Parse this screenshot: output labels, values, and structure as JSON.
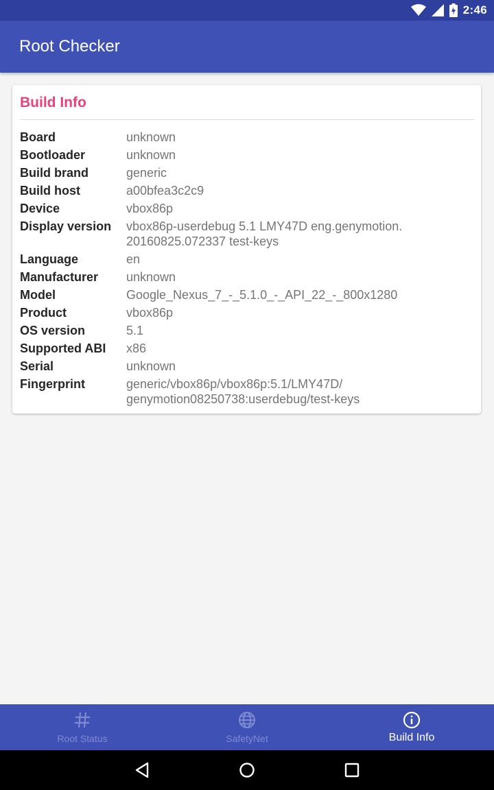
{
  "status_bar": {
    "time": "2:46",
    "icons": [
      "wifi-icon",
      "signal-icon",
      "battery-icon"
    ]
  },
  "app_bar": {
    "title": "Root Checker"
  },
  "card": {
    "title": "Build Info",
    "rows": [
      {
        "label": "Board",
        "value": "unknown"
      },
      {
        "label": "Bootloader",
        "value": "unknown"
      },
      {
        "label": "Build brand",
        "value": "generic"
      },
      {
        "label": "Build host",
        "value": "a00bfea3c2c9"
      },
      {
        "label": "Device",
        "value": "vbox86p"
      },
      {
        "label": "Display version",
        "value": "vbox86p-userdebug 5.1 LMY47D eng.genymotion.\n20160825.072337 test-keys"
      },
      {
        "label": "Language",
        "value": "en"
      },
      {
        "label": "Manufacturer",
        "value": "unknown"
      },
      {
        "label": "Model",
        "value": "Google_Nexus_7_-_5.1.0_-_API_22_-_800x1280"
      },
      {
        "label": "Product",
        "value": "vbox86p"
      },
      {
        "label": "OS version",
        "value": "5.1"
      },
      {
        "label": "Supported ABI",
        "value": "x86"
      },
      {
        "label": "Serial",
        "value": "unknown"
      },
      {
        "label": "Fingerprint",
        "value": "generic/vbox86p/vbox86p:5.1/LMY47D/\ngenymotion08250738:userdebug/test-keys"
      }
    ]
  },
  "bottom_nav": {
    "items": [
      {
        "label": "Root Status",
        "icon": "hash-icon",
        "active": false
      },
      {
        "label": "SafetyNet",
        "icon": "globe-icon",
        "active": false
      },
      {
        "label": "Build Info",
        "icon": "info-icon",
        "active": true
      }
    ]
  },
  "system_nav": {
    "buttons": [
      "back-icon",
      "home-icon",
      "recents-icon"
    ]
  },
  "colors": {
    "primary": "#3f51b5",
    "primary_dark": "#2f3f9e",
    "accent": "#e8427a",
    "inactive_nav": "#7f8ad2"
  }
}
